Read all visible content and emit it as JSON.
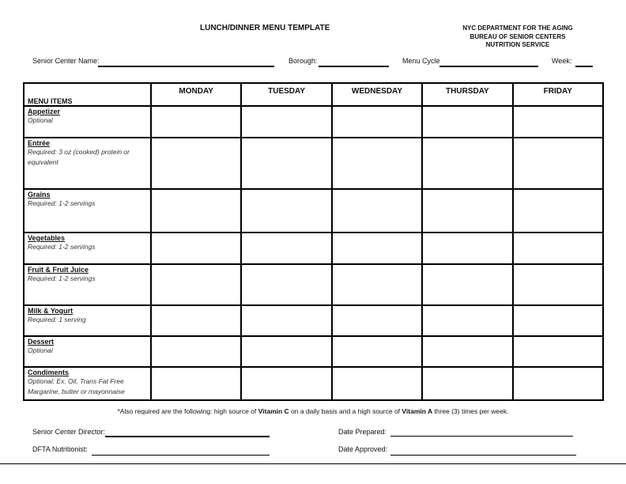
{
  "header": {
    "title": "LUNCH/DINNER MENU TEMPLATE",
    "org_lines": [
      "NYC DEPARTMENT FOR THE AGING",
      "BUREAU OF SENIOR CENTERS",
      "NUTRITION SERVICE"
    ]
  },
  "fields": {
    "senior_center_name": "Senior Center Name:",
    "borough": "Borough:",
    "menu_cycle": "Menu Cycle",
    "week": "Week:"
  },
  "table": {
    "items_header": "MENU ITEMS",
    "days": [
      "MONDAY",
      "TUESDAY",
      "WEDNESDAY",
      "THURSDAY",
      "FRIDAY"
    ],
    "rows": [
      {
        "category": "Appetizer",
        "note": "Optional"
      },
      {
        "category": "Entrée",
        "note": "Required:  3 oz (cooked) protein or equivalent"
      },
      {
        "category": "Grains",
        "note": "Required:  1-2 servings"
      },
      {
        "category": "Vegetables",
        "note": " Required:  1-2 servings"
      },
      {
        "category": "Fruit & Fruit Juice",
        "note": "Required:  1-2 servings"
      },
      {
        "category": "Milk & Yogurt",
        "note": "Required:  1 serving"
      },
      {
        "category": "Dessert",
        "note": "Optional"
      },
      {
        "category": "Condiments",
        "note": "Optional:  Ex. Oil, Trans Fat Free Margarine, butter or mayonnaise"
      }
    ]
  },
  "footnote": {
    "part1": "*Also required are the following:  high source of ",
    "vitc": "Vitamin C",
    "part2": " on a daily basis and a high source of ",
    "vita": "Vitamin A",
    "part3": " three (3) times per week."
  },
  "signatures": {
    "director": "Senior Center Director:",
    "nutritionist": "DFTA Nutritionist:",
    "date_prepared": "Date Prepared:",
    "date_approved": "Date Approved:"
  }
}
